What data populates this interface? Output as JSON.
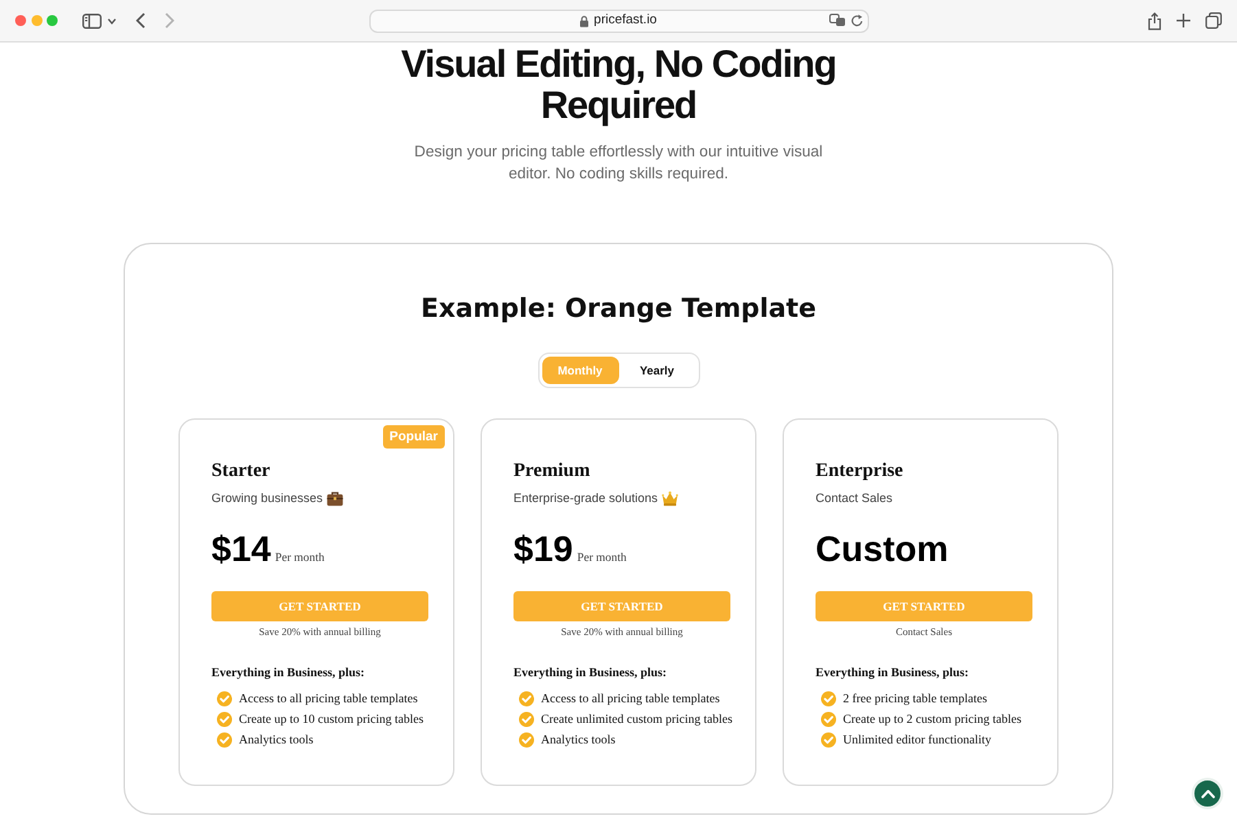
{
  "browser": {
    "url": "pricefast.io"
  },
  "hero": {
    "title": "Visual Editing, No Coding Required",
    "subtitle": "Design your pricing table effortlessly with our intuitive visual editor. No coding skills required."
  },
  "example": {
    "title": "Example: Orange Template",
    "billing_options": [
      {
        "label": "Monthly",
        "selected": true
      },
      {
        "label": "Yearly",
        "selected": false
      }
    ],
    "plans": [
      {
        "kind": "briefcase",
        "name": "Starter",
        "tagline": "Growing businesses",
        "badge": "Popular",
        "price": "$14",
        "period": "Per month",
        "button": "GET STARTED",
        "note": "Save 20% with annual billing",
        "features_heading": "Everything in Business, plus:",
        "features": [
          "Access to all pricing table templates",
          "Create up to 10 custom pricing tables",
          "Analytics tools"
        ]
      },
      {
        "kind": "crown",
        "name": "Premium",
        "tagline": "Enterprise-grade solutions",
        "price": "$19",
        "period": "Per month",
        "button": "GET STARTED",
        "note": "Save 20% with annual billing",
        "features_heading": "Everything in Business, plus:",
        "features": [
          "Access to all pricing table templates",
          "Create unlimited custom pricing tables",
          "Analytics tools"
        ]
      },
      {
        "kind": "plain",
        "name": "Enterprise",
        "tagline": "Contact Sales",
        "price": "Custom",
        "button": "GET STARTED",
        "note": "Contact Sales",
        "features_heading": "Everything in Business, plus:",
        "features": [
          "2 free pricing table templates",
          "Create up to 2 custom pricing tables",
          "Unlimited editor functionality"
        ]
      }
    ]
  }
}
